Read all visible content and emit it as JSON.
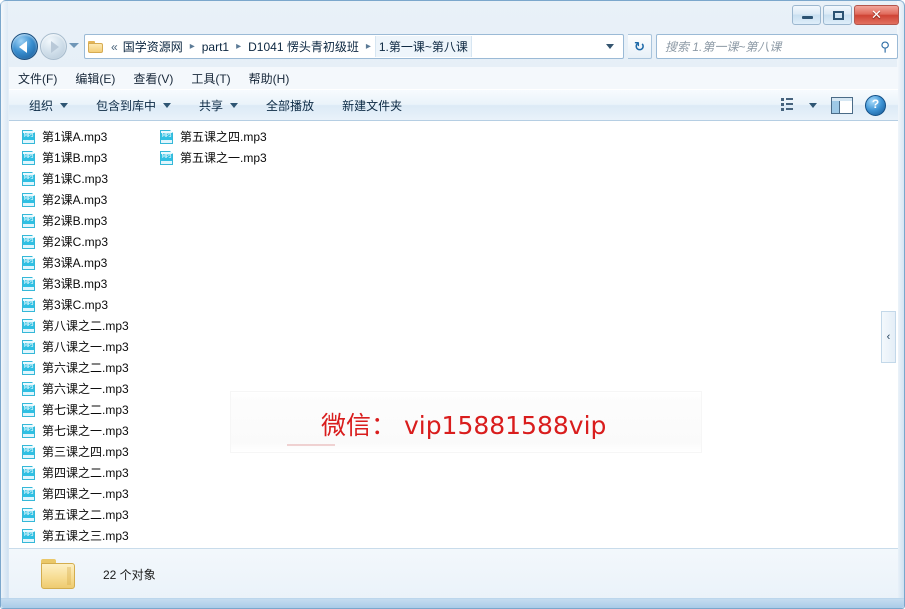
{
  "window": {
    "controls": {
      "minimize_label": "–",
      "maximize_label": "□",
      "close_label": "✕"
    }
  },
  "navigation": {
    "back_tooltip": "后退",
    "forward_tooltip": "前进",
    "history_tooltip": "最近的页面",
    "address": {
      "overflow_label": "«",
      "crumbs": [
        {
          "label": "国学资源网"
        },
        {
          "label": "part1"
        },
        {
          "label": "D1041 愣头青初级班"
        },
        {
          "label": "1.第一课~第八课"
        }
      ],
      "separator": "▸"
    },
    "refresh_label": "↻",
    "search": {
      "placeholder": "搜索 1.第一课~第八课",
      "value": "",
      "icon_label": "⚲"
    }
  },
  "menubar": {
    "items": [
      {
        "label": "文件(F)"
      },
      {
        "label": "编辑(E)"
      },
      {
        "label": "查看(V)"
      },
      {
        "label": "工具(T)"
      },
      {
        "label": "帮助(H)"
      }
    ]
  },
  "toolbar": {
    "items": [
      {
        "label": "组织",
        "has_caret": true
      },
      {
        "label": "包含到库中",
        "has_caret": true
      },
      {
        "label": "共享",
        "has_caret": true
      },
      {
        "label": "全部播放",
        "has_caret": false
      },
      {
        "label": "新建文件夹",
        "has_caret": false
      }
    ],
    "view_options_tooltip": "更改您的视图",
    "preview_pane_tooltip": "显示预览窗格",
    "help_label": "?"
  },
  "files": {
    "column1": [
      {
        "name": "第1课A.mp3"
      },
      {
        "name": "第1课B.mp3"
      },
      {
        "name": "第1课C.mp3"
      },
      {
        "name": "第2课A.mp3"
      },
      {
        "name": "第2课B.mp3"
      },
      {
        "name": "第2课C.mp3"
      },
      {
        "name": "第3课A.mp3"
      },
      {
        "name": "第3课B.mp3"
      },
      {
        "name": "第3课C.mp3"
      },
      {
        "name": "第八课之二.mp3"
      },
      {
        "name": "第八课之一.mp3"
      },
      {
        "name": "第六课之二.mp3"
      },
      {
        "name": "第六课之一.mp3"
      },
      {
        "name": "第七课之二.mp3"
      },
      {
        "name": "第七课之一.mp3"
      },
      {
        "name": "第三课之四.mp3"
      },
      {
        "name": "第四课之二.mp3"
      },
      {
        "name": "第四课之一.mp3"
      },
      {
        "name": "第五课之二.mp3"
      },
      {
        "name": "第五课之三.mp3"
      }
    ],
    "column2": [
      {
        "name": "第五课之四.mp3"
      },
      {
        "name": "第五课之一.mp3"
      }
    ]
  },
  "watermark": {
    "text": "微信： vip15881588vip",
    "color": "#d91d1d"
  },
  "preview_pane": {
    "handle_label": "‹"
  },
  "statusbar": {
    "item_count_text": "22 个对象"
  }
}
